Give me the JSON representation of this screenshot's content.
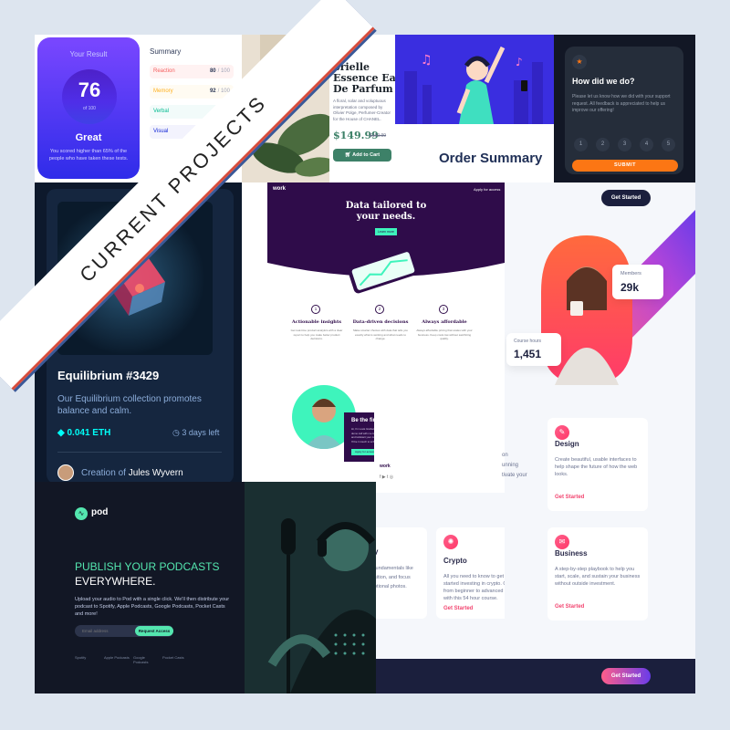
{
  "ribbon": {
    "label": "CURRENT PROJECTS"
  },
  "results": {
    "heading": "Your Result",
    "score": "76",
    "out_of": "of 100",
    "grade": "Great",
    "description": "You scored higher than 65% of the people who have taken these tests.",
    "summary_title": "Summary",
    "rows": [
      {
        "label": "Reaction",
        "value": "80",
        "max": "/ 100",
        "color": "#fff2f2",
        "text": "#f55e5e"
      },
      {
        "label": "Memory",
        "value": "92",
        "max": "/ 100",
        "color": "#fffbf2",
        "text": "#ffb01f"
      },
      {
        "label": "Verbal",
        "value": "",
        "max": "",
        "color": "#f2fbfa",
        "text": "#00bb8f"
      },
      {
        "label": "Visual",
        "value": "",
        "max": "",
        "color": "#f3f3fd",
        "text": "#1125d6"
      }
    ]
  },
  "perfume": {
    "title_lines": [
      "brielle",
      "Essence Eau",
      "De Parfum"
    ],
    "description": "A floral, solar and voluptuous interpretation composed by Olivier Polge, Perfumer-Creator for the House of CHANEL.",
    "price": "$149.99",
    "old_price": "$169.99",
    "cart_button": "Add to Cart"
  },
  "music": {
    "title": "Order Summary"
  },
  "rating": {
    "title": "How did we do?",
    "description": "Please let us know how we did with your support request. All feedback is appreciated to help us improve our offering!",
    "options": [
      "1",
      "2",
      "3",
      "4",
      "5"
    ],
    "submit": "SUBMIT"
  },
  "nft": {
    "title": "Equilibrium #3429",
    "description": "Our Equilibrium collection promotes balance and calm.",
    "price": "0.041 ETH",
    "time_left": "3 days left",
    "creation_prefix": "Creation of",
    "creator": "Jules Wyvern"
  },
  "workit": {
    "logo": "work",
    "nav_link": "Apply for access",
    "hero_title": "Data tailored to your needs.",
    "hero_cta": "Learn more",
    "features": [
      {
        "num": "1",
        "title": "Actionable insights",
        "text": "Get real-time product analytics with a clear report to help you make better product decisions."
      },
      {
        "num": "2",
        "title": "Data-driven decisions",
        "text": "Make smarter choices with data that tells you exactly what is working and what needs to change."
      },
      {
        "num": "3",
        "title": "Always affordable",
        "text": "Always affordable pricing that scales with your business. Keep costs low without sacrificing quality."
      }
    ],
    "test_title": "Be the first to test",
    "test_text": "Hi, I'm Louis Graham, the founder of the company. Book a demo call with me to become a beta tester for our app and kickstart your company. Apply for access below and I'll be in touch to schedule a call.",
    "test_cta": "Apply for access"
  },
  "courses": {
    "cta_top": "Get Started",
    "members_label": "Members",
    "members_value": "29k",
    "hours_label": "Course hours",
    "hours_value": "1,451",
    "cards": [
      {
        "icon": "✎",
        "title": "Design",
        "desc": "Create beautiful, usable interfaces to help shape the future of how the web looks.",
        "link": "Get Started"
      },
      {
        "icon": "✺",
        "title": "Crypto",
        "desc": "All you need to know to get started investing in crypto. Go from beginner to advanced with this 54 hour course.",
        "link": "Get Started"
      },
      {
        "icon": "✉",
        "title": "Business",
        "desc": "A step-by-step playbook to help you start, scale, and sustain your business without outside investment.",
        "link": "Get Started"
      }
    ],
    "partial_lines": [
      "on",
      "unning",
      "tivate your"
    ],
    "partial_photo": [
      "fundamentals like",
      "sition, and focus",
      "otional photos."
    ],
    "partial_title": "y",
    "cta_bottom": "Get Started"
  },
  "pod": {
    "logo": "pod",
    "headline_1": "PUBLISH YOUR PODCASTS",
    "headline_2": "EVERYWHERE.",
    "description": "Upload your audio to Pod with a single click. We'll then distribute your podcast to Spotify, Apple Podcasts, Google Podcasts, Pocket Casts and more!",
    "email_placeholder": "Email address",
    "cta": "Request Access",
    "platforms": [
      "Spotify",
      "Apple Podcasts",
      "Google Podcasts",
      "Pocket Casts"
    ]
  }
}
